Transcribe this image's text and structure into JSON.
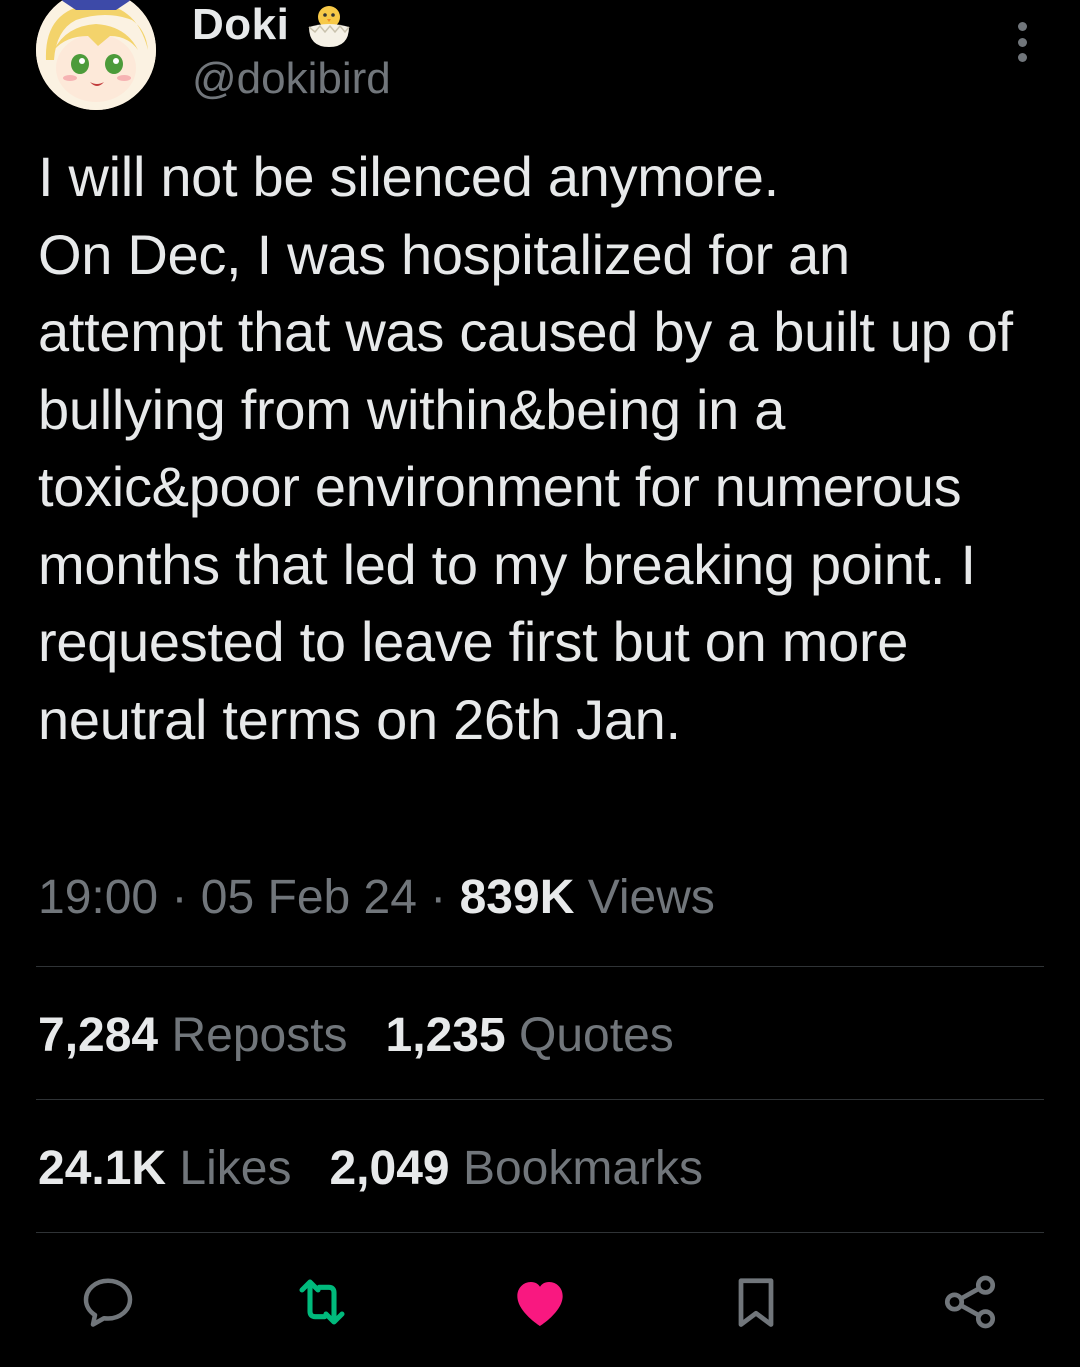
{
  "author": {
    "display_name": "Doki",
    "handle": "@dokibird",
    "badge_icon": "hatching-chick-icon"
  },
  "tweet": {
    "text": "I will not be silenced anymore.\nOn Dec, I was hospitalized for an attempt that was caused by a built up of bullying from within&being in a toxic&poor environment for numerous months that led to my breaking point. I requested to leave first but on more neutral terms on 26th Jan."
  },
  "meta": {
    "time": "19:00",
    "separator": " · ",
    "date": "05 Feb 24",
    "views_count": "839K",
    "views_label": " Views"
  },
  "stats": {
    "reposts_count": "7,284",
    "reposts_label": " Reposts",
    "quotes_count": "1,235",
    "quotes_label": " Quotes",
    "likes_count": "24.1K",
    "likes_label": " Likes",
    "bookmarks_count": "2,049",
    "bookmarks_label": " Bookmarks"
  },
  "actions": {
    "reply_icon": "reply-icon",
    "repost_icon": "repost-icon",
    "like_icon": "heart-icon",
    "bookmark_icon": "bookmark-icon",
    "share_icon": "share-icon"
  },
  "colors": {
    "background": "#000000",
    "text": "#e7e9ea",
    "muted": "#71767b",
    "divider": "#2f3336",
    "repost_active": "#00ba7c",
    "like_active": "#f91880"
  }
}
